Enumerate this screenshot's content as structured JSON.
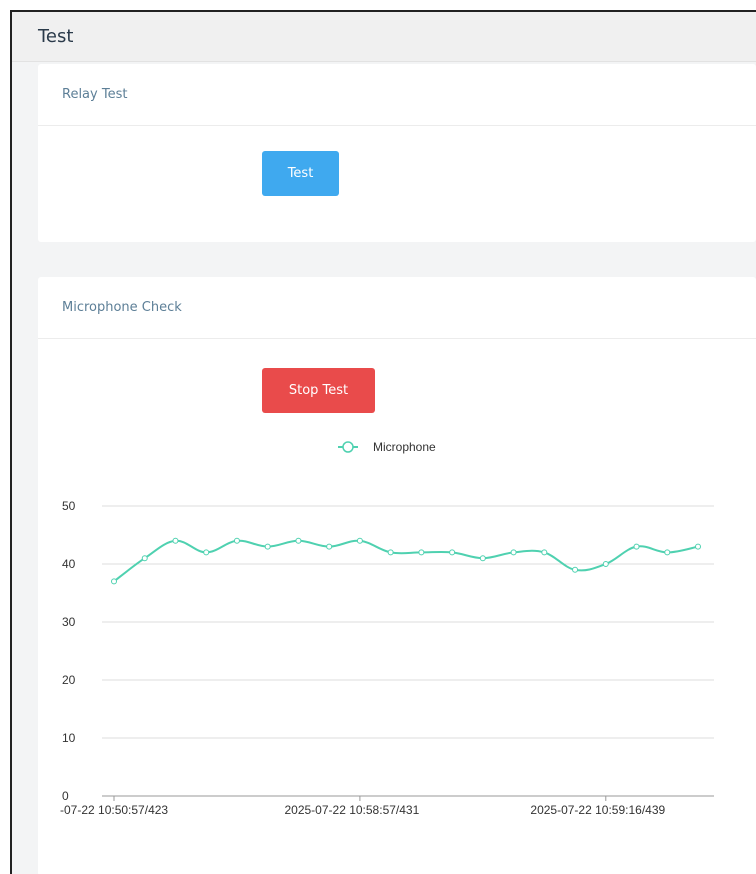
{
  "header": {
    "title": "Test"
  },
  "relay_card": {
    "title": "Relay Test",
    "button_label": "Test"
  },
  "mic_card": {
    "title": "Microphone Check",
    "button_label": "Stop Test"
  },
  "colors": {
    "test_button": "#3fa9ef",
    "stop_button": "#e94b4b",
    "series": "#4fd1b0",
    "card_title": "#5d7f97"
  },
  "chart_data": {
    "type": "line",
    "legend": {
      "entries": [
        "Microphone"
      ],
      "placement": "top-center"
    },
    "series": [
      {
        "name": "Microphone",
        "values": [
          37,
          41,
          44,
          42,
          44,
          43,
          44,
          43,
          44,
          42,
          42,
          42,
          41,
          42,
          42,
          39,
          40,
          43,
          42,
          43
        ]
      }
    ],
    "x_tick_labels": [
      "-07-22 10:50:57/423",
      "2025-07-22 10:58:57/431",
      "2025-07-22 10:59:16/439"
    ],
    "x_tick_indices": [
      0,
      8,
      16
    ],
    "y_ticks": [
      0,
      10,
      20,
      30,
      40,
      50
    ],
    "ylim": [
      0,
      50
    ],
    "grid": "horizontal"
  }
}
